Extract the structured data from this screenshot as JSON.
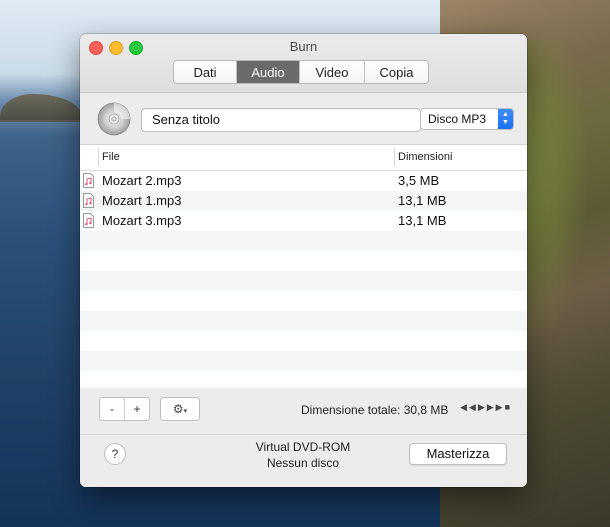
{
  "window": {
    "title": "Burn"
  },
  "tabs": [
    {
      "label": "Dati",
      "active": false
    },
    {
      "label": "Audio",
      "active": true
    },
    {
      "label": "Video",
      "active": false
    },
    {
      "label": "Copia",
      "active": false
    }
  ],
  "disc": {
    "title_value": "Senza titolo",
    "format_selected": "Disco MP3"
  },
  "table": {
    "columns": [
      "File",
      "Dimensioni"
    ],
    "rows": [
      {
        "file": "Mozart 2.mp3",
        "size": "3,5 MB"
      },
      {
        "file": "Mozart 1.mp3",
        "size": "13,1 MB"
      },
      {
        "file": "Mozart 3.mp3",
        "size": "13,1 MB"
      }
    ]
  },
  "toolbar": {
    "remove_label": "-",
    "add_label": "+",
    "total_label": "Dimensione totale: 30,8 MB"
  },
  "footer": {
    "device_name": "Virtual DVD-ROM",
    "device_status": "Nessun disco",
    "help_label": "?",
    "burn_label": "Masterizza"
  },
  "icons": [
    "disc-icon",
    "audio-file-icon",
    "gear-icon",
    "rewind-icon",
    "play-icon",
    "fast-forward-icon",
    "stop-icon"
  ]
}
